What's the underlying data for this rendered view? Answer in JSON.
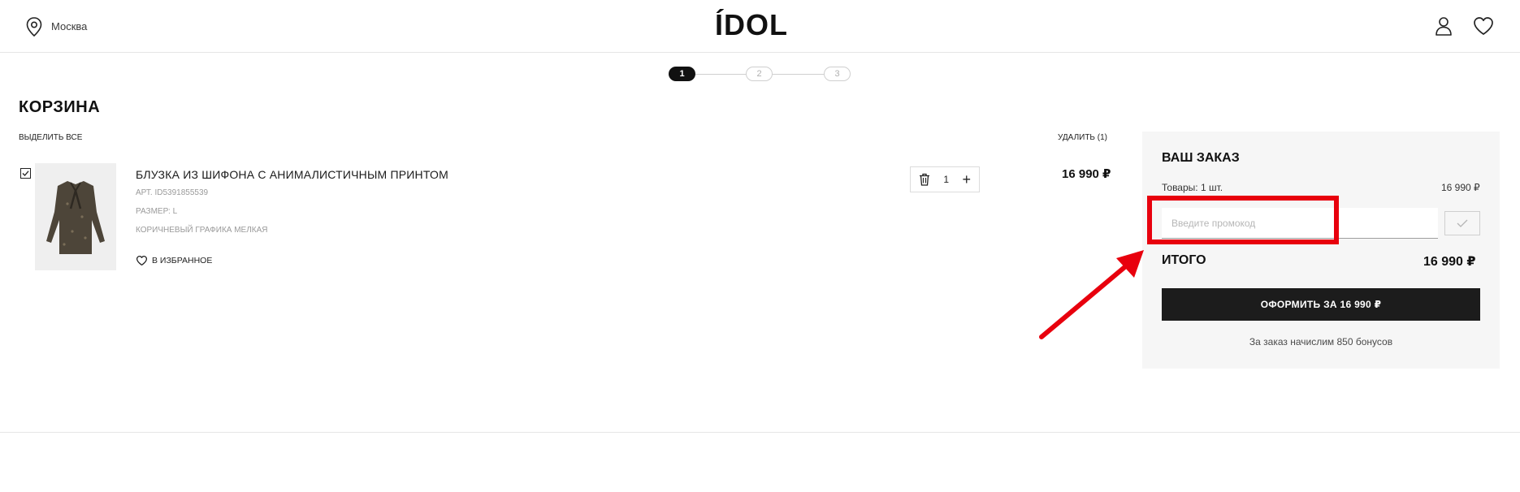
{
  "header": {
    "location": "Москва",
    "logo": "ÍDOL"
  },
  "steps": [
    "1",
    "2",
    "3"
  ],
  "cart": {
    "title": "КОРЗИНА",
    "select_all": "ВЫДЕЛИТЬ ВСЕ",
    "delete_label": "УДАЛИТЬ (1)"
  },
  "product": {
    "name": "БЛУЗКА ИЗ ШИФОНА С АНИМАЛИСТИЧНЫМ ПРИНТОМ",
    "article": "АРТ. ID5391855539",
    "size": "РАЗМЕР: L",
    "color": "КОРИЧНЕВЫЙ ГРАФИКА МЕЛКАЯ",
    "favorite_label": "В ИЗБРАННОЕ",
    "quantity": "1",
    "plus": "+",
    "price": "16 990 ₽"
  },
  "order": {
    "title": "ВАШ ЗАКАЗ",
    "goods_label": "Товары: 1 шт.",
    "goods_price": "16 990 ₽",
    "promo_placeholder": "Введите промокод",
    "total_label": "ИТОГО",
    "total_price": "16 990 ₽",
    "checkout_label": "ОФОРМИТЬ ЗА 16 990 ₽",
    "bonus_text": "За заказ начислим 850 бонусов"
  },
  "annotation": {
    "highlight_color": "#e8000d"
  }
}
